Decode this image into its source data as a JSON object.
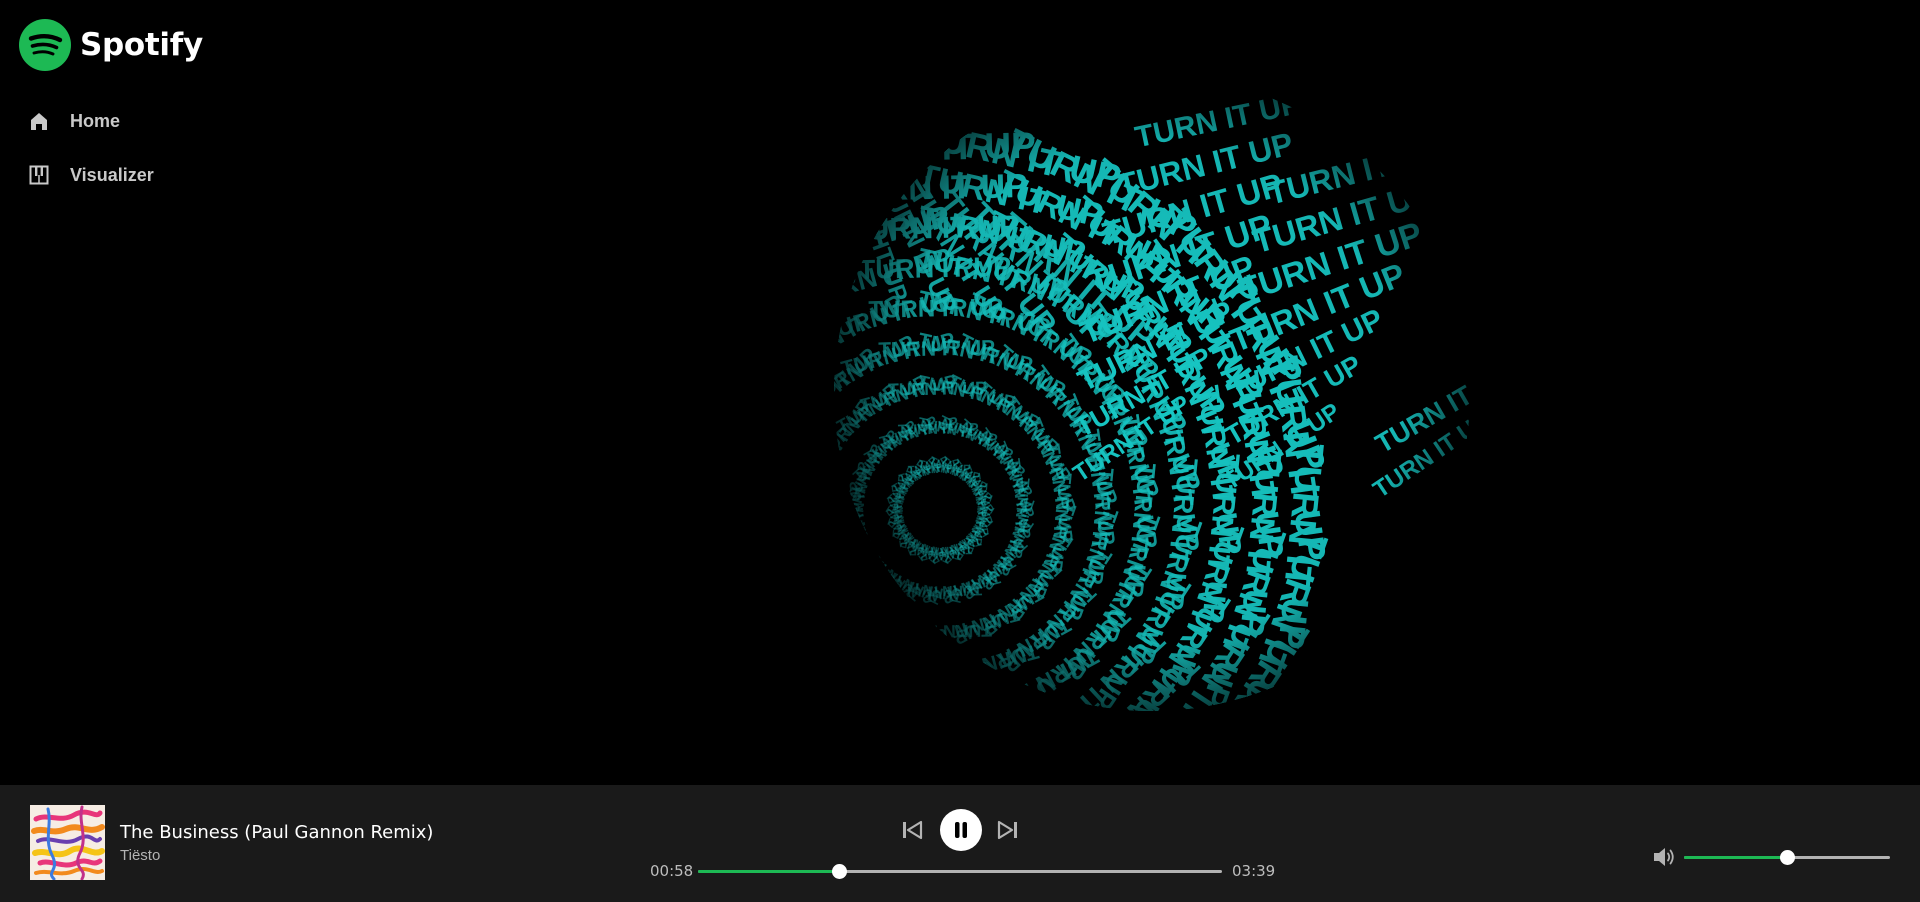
{
  "app": {
    "name": "Spotify",
    "accent_color": "#1db954",
    "logo_icon": "spotify-logo-icon"
  },
  "sidebar": {
    "items": [
      {
        "label": "Home",
        "icon": "home-icon"
      },
      {
        "label": "Visualizer",
        "icon": "piano-icon"
      }
    ]
  },
  "visualizer": {
    "text": "TURN IT UP",
    "color": "#17c9c6",
    "background": "#000000"
  },
  "player": {
    "track_title": "The Business (Paul Gannon Remix)",
    "artist": "Tiësto",
    "current_time": "00:58",
    "total_time": "03:39",
    "progress_fraction": 0.27,
    "volume_fraction": 0.5,
    "state": "playing",
    "background": "#1a1a1a"
  }
}
